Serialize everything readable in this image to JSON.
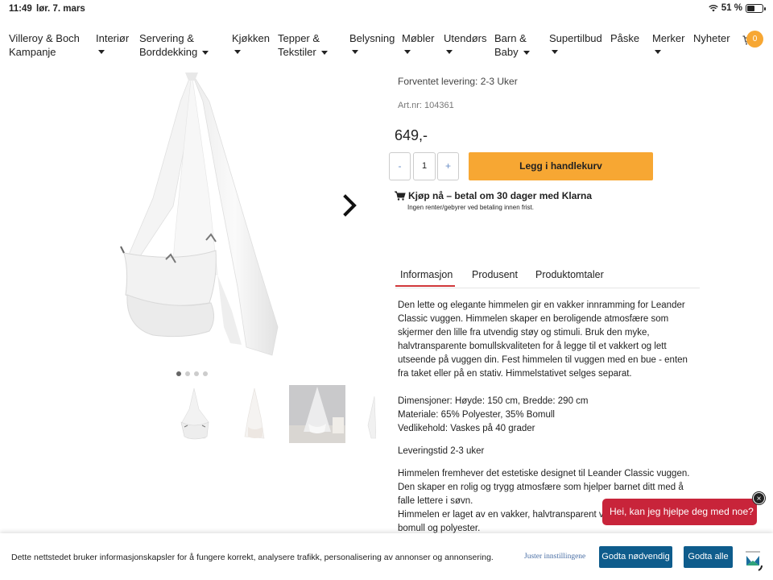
{
  "status_bar": {
    "time": "11:49",
    "date": "lør. 7. mars",
    "battery": "51 %"
  },
  "nav": {
    "items": [
      {
        "line1": "Villeroy & Boch",
        "line2": "Kampanje"
      },
      {
        "line1": "Interiør",
        "line2": ""
      },
      {
        "line1": "Servering &",
        "line2": "Borddekking"
      },
      {
        "line1": "Kjøkken",
        "line2": ""
      },
      {
        "line1": "Tepper &",
        "line2": "Tekstiler"
      },
      {
        "line1": "Belysning",
        "line2": ""
      },
      {
        "line1": "Møbler",
        "line2": ""
      },
      {
        "line1": "Utendørs",
        "line2": ""
      },
      {
        "line1": "Barn &",
        "line2": "Baby"
      },
      {
        "line1": "Supertilbud",
        "line2": ""
      },
      {
        "line1": "Påske",
        "line2": ""
      },
      {
        "line1": "Merker",
        "line2": ""
      },
      {
        "line1": "Nyheter",
        "line2": ""
      }
    ],
    "cart_count": "0"
  },
  "product": {
    "delivery": "Forventet levering: 2-3 Uker",
    "artnr": "Art.nr: 104361",
    "price": "649,-",
    "qty_minus": "-",
    "qty_value": "1",
    "qty_plus": "+",
    "add_to_cart": "Legg i handlekurv",
    "klarna": "Kjøp nå – betal om 30 dager med Klarna",
    "klarna_sub": "Ingen renter/gebyrer ved betaling innen frist."
  },
  "tabs": [
    "Informasjon",
    "Produsent",
    "Produktomtaler"
  ],
  "description": {
    "p1": "Den lette og elegante himmelen gir en vakker innramming for Leander Classic vuggen. Himmelen skaper en beroligende atmosfære som skjermer den lille fra utvendig støy og stimuli. Bruk den myke, halvtransparente bomullskvaliteten for å legge til et vakkert og lett utseende på vuggen din. Fest himmelen til vuggen med en bue - enten fra taket eller på en stativ. Himmelstativet selges separat.",
    "dim": "Dimensjoner: Høyde: 150 cm, Bredde: 290 cm",
    "mat": "Materiale: 65% Polyester, 35% Bomull",
    "care": "Vedlikehold: Vaskes på 40 grader",
    "lead": "Leveringstid 2-3 uker",
    "p2a": "Himmelen fremhever det estetiske designet til Leander Classic vuggen.",
    "p2b": "Den skaper en rolig og trygg atmosfære som hjelper barnet ditt med å falle lettere i søvn.",
    "p2c": "Himmelen er laget av en vakker, halvtransparent voile-blanding av bomull og polyester."
  },
  "cookie": {
    "text": "Dette nettstedet bruker informasjonskapsler for å fungere korrekt, analysere trafikk, personalisering av annonser og annonsering.",
    "adjust": "Juster innstillingene",
    "necessary": "Godta nødvendig",
    "all": "Godta alle"
  },
  "chat": {
    "text": "Hei, kan jeg hjelpe deg med noe?",
    "close": "×"
  },
  "icons": {
    "wifi": "wifi-icon",
    "battery": "battery-icon",
    "cart": "cart-icon",
    "next": "chevron-right-icon",
    "close": "close-icon"
  },
  "colors": {
    "accent": "#f7a733",
    "tab_active": "#d0373a",
    "cookie_button": "#0e5c8c",
    "chat": "#c8243a"
  }
}
